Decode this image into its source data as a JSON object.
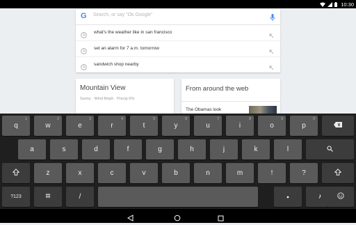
{
  "status_bar": {
    "time": "10:30"
  },
  "search": {
    "logo": "G",
    "placeholder": "Search, or say \"Ok Google\"",
    "suggestions": [
      "what's the weather like in san francisco",
      "set an alarm for 7 a.m. tomorrow",
      "sandwich shop nearby"
    ]
  },
  "weather_card": {
    "city": "Mountain View",
    "details": "Sunny · Wind 8mph · Precip 0%"
  },
  "web_card": {
    "title": "From around the web",
    "story": "The Obamas look"
  },
  "keyboard": {
    "row1": [
      "q",
      "w",
      "e",
      "r",
      "t",
      "y",
      "u",
      "i",
      "o",
      "p"
    ],
    "row1_hints": [
      "1",
      "2",
      "3",
      "4",
      "5",
      "6",
      "7",
      "8",
      "9",
      "0"
    ],
    "row2": [
      "a",
      "s",
      "d",
      "f",
      "g",
      "h",
      "j",
      "k",
      "l"
    ],
    "row3": [
      "z",
      "x",
      "c",
      "v",
      "b",
      "n",
      "m",
      "!",
      "?"
    ],
    "row4": {
      "symbols": "?123",
      "slash": "/"
    },
    "icons": [
      "backspace-icon",
      "search-icon",
      "shift-icon",
      "settings-icon",
      "emoji-icon"
    ]
  },
  "nav_bar": {
    "icons": [
      "back-icon",
      "home-icon",
      "recents-icon"
    ]
  }
}
